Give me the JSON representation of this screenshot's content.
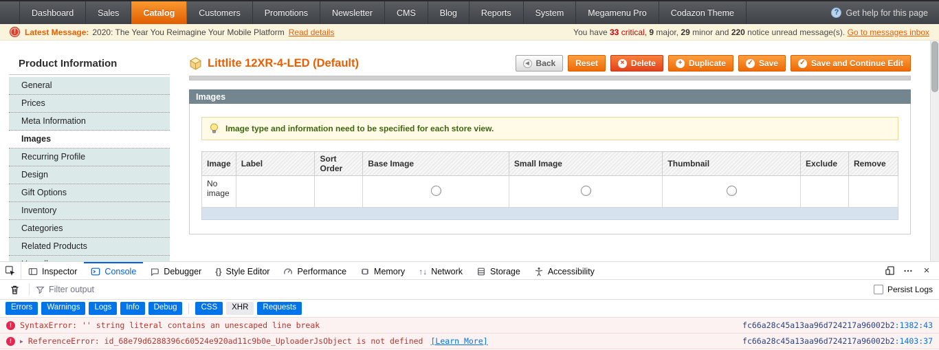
{
  "topnav": {
    "items": [
      {
        "label": "Dashboard",
        "active": false
      },
      {
        "label": "Sales",
        "active": false
      },
      {
        "label": "Catalog",
        "active": true
      },
      {
        "label": "Customers",
        "active": false
      },
      {
        "label": "Promotions",
        "active": false
      },
      {
        "label": "Newsletter",
        "active": false
      },
      {
        "label": "CMS",
        "active": false
      },
      {
        "label": "Blog",
        "active": false
      },
      {
        "label": "Reports",
        "active": false
      },
      {
        "label": "System",
        "active": false
      },
      {
        "label": "Megamenu Pro",
        "active": false
      },
      {
        "label": "Codazon Theme",
        "active": false
      }
    ],
    "help_label": "Get help for this page"
  },
  "messagebar": {
    "label": "Latest Message:",
    "message": "2020: The Year You Reimagine Your Mobile Platform",
    "read_details": "Read details",
    "summary": {
      "you_have": "You have ",
      "critical_count": "33",
      "critical_text": " critical, ",
      "major_count": "9",
      "major_text": " major, ",
      "minor_count": "29",
      "minor_text": " minor and ",
      "notice_count": "220",
      "notice_text": " notice unread message(s). ",
      "inbox_link": "Go to messages inbox"
    }
  },
  "sidebar": {
    "title": "Product Information",
    "items": [
      {
        "label": "General",
        "active": false
      },
      {
        "label": "Prices",
        "active": false
      },
      {
        "label": "Meta Information",
        "active": false
      },
      {
        "label": "Images",
        "active": true
      },
      {
        "label": "Recurring Profile",
        "active": false
      },
      {
        "label": "Design",
        "active": false
      },
      {
        "label": "Gift Options",
        "active": false
      },
      {
        "label": "Inventory",
        "active": false
      },
      {
        "label": "Categories",
        "active": false
      },
      {
        "label": "Related Products",
        "active": false
      },
      {
        "label": "Up-sells",
        "active": false
      }
    ]
  },
  "page": {
    "title": "Littlite 12XR-4-LED (Default)"
  },
  "actions": {
    "back": "Back",
    "reset": "Reset",
    "delete": "Delete",
    "duplicate": "Duplicate",
    "save": "Save",
    "save_and_continue": "Save and Continue Edit"
  },
  "images_panel": {
    "title": "Images",
    "note": "Image type and information need to be specified for each store view.",
    "table": {
      "headers": [
        "Image",
        "Label",
        "Sort Order",
        "Base Image",
        "Small Image",
        "Thumbnail",
        "Exclude",
        "Remove"
      ],
      "empty_row_label": "No image"
    }
  },
  "devtools": {
    "tabs": [
      {
        "label": "Inspector",
        "active": false
      },
      {
        "label": "Console",
        "active": true
      },
      {
        "label": "Debugger",
        "active": false
      },
      {
        "label": "Style Editor",
        "active": false
      },
      {
        "label": "Performance",
        "active": false
      },
      {
        "label": "Memory",
        "active": false
      },
      {
        "label": "Network",
        "active": false
      },
      {
        "label": "Storage",
        "active": false
      },
      {
        "label": "Accessibility",
        "active": false
      }
    ],
    "filter_placeholder": "Filter output",
    "persist_logs_label": "Persist Logs",
    "filters": [
      {
        "label": "Errors",
        "active": true
      },
      {
        "label": "Warnings",
        "active": true
      },
      {
        "label": "Logs",
        "active": true
      },
      {
        "label": "Info",
        "active": true
      },
      {
        "label": "Debug",
        "active": true
      },
      {
        "label": "CSS",
        "active": true
      },
      {
        "label": "XHR",
        "active": false
      },
      {
        "label": "Requests",
        "active": true
      }
    ]
  },
  "console": {
    "messages": [
      {
        "severity": "error",
        "text": "SyntaxError: '' string literal contains an unescaped line break",
        "source_file": "fc66a28c45a13aa96d724217a96002b2",
        "source_position": "1382:43",
        "expandable": false
      },
      {
        "severity": "error",
        "text": "ReferenceError: id_68e79d6288396c60524e920ad11c9b0e_UploaderJsObject is not defined",
        "learn_more": "[Learn More]",
        "source_file": "fc66a28c45a13aa96d724217a96002b2",
        "source_position": "1403:37",
        "expandable": true
      }
    ]
  },
  "icons": {
    "alert_exclamation": "!",
    "help_question": "?",
    "back_arrow": "◀",
    "delete_x": "×",
    "duplicate_plus": "+",
    "save_check": "✓",
    "braces": "{}",
    "network_arrows": "↑↓",
    "close": "×",
    "error_exclamation": "!",
    "expand_triangle": "▶"
  },
  "colors": {
    "magento_orange": "#eb5e00",
    "nav_active_orange": "#e8650a",
    "panel_header_bg": "#73858e",
    "sidebar_item_bg": "#dce9e9",
    "note_green": "#3d6611",
    "devtools_accent": "#0060df",
    "filter_button_blue": "#0074e8",
    "error_text": "#b3362f",
    "error_bg": "#fdf2f2"
  }
}
